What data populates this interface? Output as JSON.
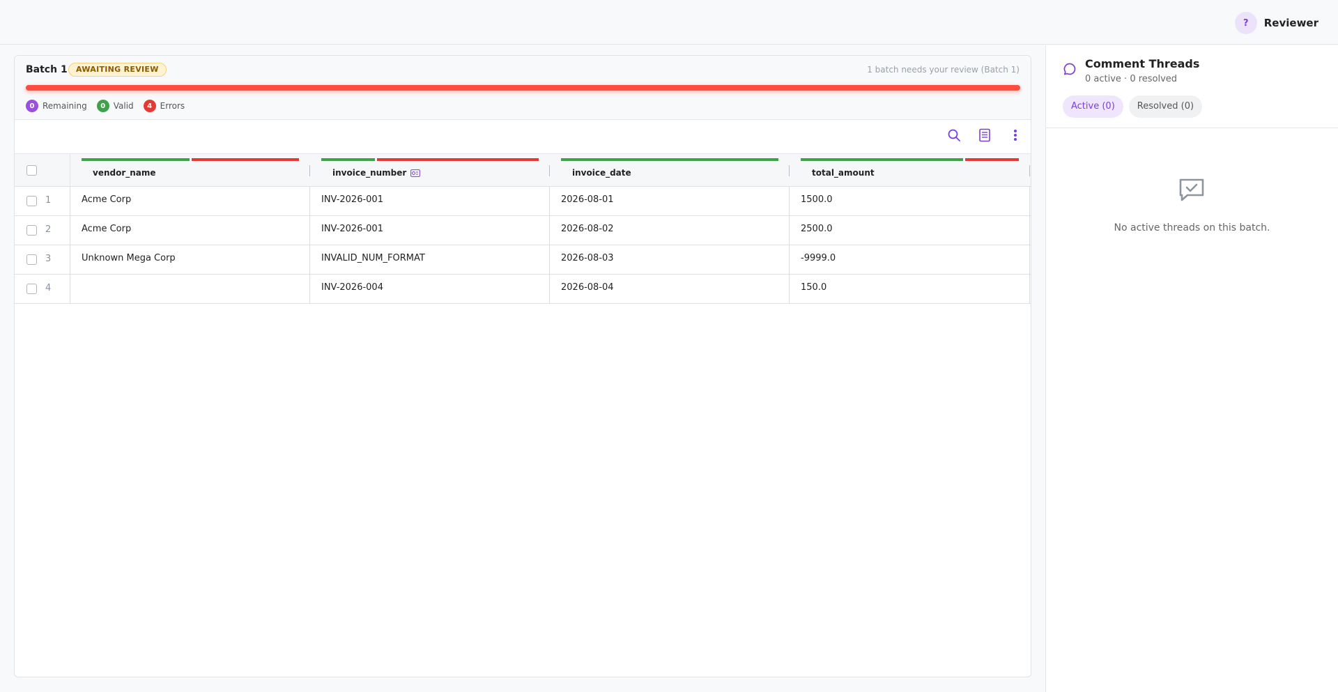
{
  "user": {
    "avatar_initial": "?",
    "role": "Reviewer"
  },
  "batch": {
    "title": "Batch 1",
    "status_badge": "AWAITING REVIEW",
    "review_note": "1 batch needs your review (Batch 1)",
    "progress_color": "#ff4d3d",
    "stats": {
      "remaining_count": "0",
      "remaining_label": "Remaining",
      "valid_count": "0",
      "valid_label": "Valid",
      "errors_count": "4",
      "errors_label": "Errors"
    }
  },
  "toolbar": {
    "icons": [
      "search-icon",
      "report-icon",
      "more-vertical-icon"
    ]
  },
  "table": {
    "columns": [
      {
        "label": "vendor_name",
        "quality": {
          "valid": 0.5,
          "error": 0.5
        },
        "key_icon": false
      },
      {
        "label": "invoice_number",
        "quality": {
          "valid": 0.25,
          "error": 0.75
        },
        "key_icon": true
      },
      {
        "label": "invoice_date",
        "quality": {
          "valid": 1.0,
          "error": 0.0
        },
        "key_icon": false
      },
      {
        "label": "total_amount",
        "quality": {
          "valid": 0.75,
          "error": 0.25
        },
        "key_icon": false
      }
    ],
    "rows": [
      {
        "num": "1",
        "vendor_name": "Acme Corp",
        "invoice_number": "INV-2026-001",
        "invoice_date": "2026-08-01",
        "total_amount": "1500.0"
      },
      {
        "num": "2",
        "vendor_name": "Acme Corp",
        "invoice_number": "INV-2026-001",
        "invoice_date": "2026-08-02",
        "total_amount": "2500.0"
      },
      {
        "num": "3",
        "vendor_name": "Unknown Mega Corp",
        "invoice_number": "INVALID_NUM_FORMAT",
        "invoice_date": "2026-08-03",
        "total_amount": "-9999.0"
      },
      {
        "num": "4",
        "vendor_name": "",
        "invoice_number": "INV-2026-004",
        "invoice_date": "2026-08-04",
        "total_amount": "150.0"
      }
    ]
  },
  "colors": {
    "valid": "#3fa24a",
    "error": "#e53935",
    "remaining": "#9b4fe0",
    "accent": "#7b3fd6"
  },
  "comments": {
    "title": "Comment Threads",
    "subtitle": "0 active · 0 resolved",
    "tab_active": "Active (0)",
    "tab_resolved": "Resolved (0)",
    "empty_text": "No active threads on this batch."
  }
}
